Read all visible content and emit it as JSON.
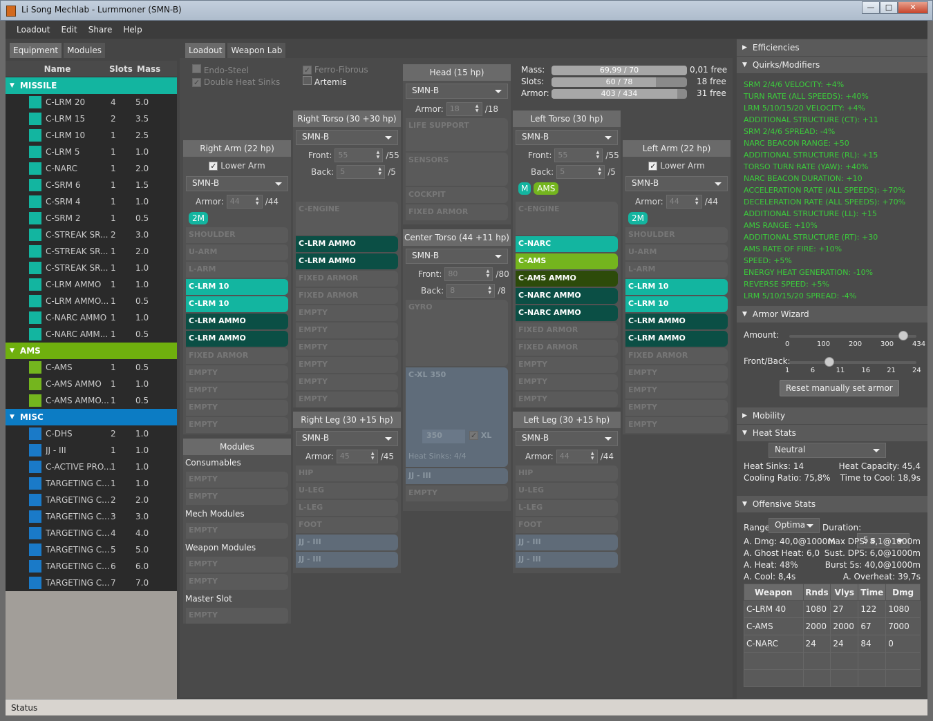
{
  "window": {
    "title": "Li Song Mechlab - Lurmmoner (SMN-B)",
    "min": "—",
    "max": "□",
    "close": "✕"
  },
  "menu": [
    "Loadout",
    "Edit",
    "Share",
    "Help"
  ],
  "left_tabs": [
    "Equipment",
    "Modules"
  ],
  "equipment": {
    "headers": {
      "name": "Name",
      "slots": "Slots",
      "mass": "Mass"
    },
    "categories": [
      {
        "name": "MISSILE",
        "color": "#13b5a0",
        "item_color": "#13b5a0",
        "items": [
          [
            "C-LRM 20",
            "4",
            "5.0"
          ],
          [
            "C-LRM 15",
            "2",
            "3.5"
          ],
          [
            "C-LRM 10",
            "1",
            "2.5"
          ],
          [
            "C-LRM 5",
            "1",
            "1.0"
          ],
          [
            "C-NARC",
            "1",
            "2.0"
          ],
          [
            "C-SRM 6",
            "1",
            "1.5"
          ],
          [
            "C-SRM 4",
            "1",
            "1.0"
          ],
          [
            "C-SRM 2",
            "1",
            "0.5"
          ],
          [
            "C-STREAK SR...",
            "2",
            "3.0"
          ],
          [
            "C-STREAK SR...",
            "1",
            "2.0"
          ],
          [
            "C-STREAK SR...",
            "1",
            "1.0"
          ],
          [
            "C-LRM AMMO",
            "1",
            "1.0"
          ],
          [
            "C-LRM AMMO...",
            "1",
            "0.5"
          ],
          [
            "C-NARC AMMO",
            "1",
            "1.0"
          ],
          [
            "C-NARC AMM...",
            "1",
            "0.5"
          ]
        ]
      },
      {
        "name": "AMS",
        "color": "#6fb00e",
        "item_color": "#74b51e",
        "items": [
          [
            "C-AMS",
            "1",
            "0.5"
          ],
          [
            "C-AMS AMMO",
            "1",
            "1.0"
          ],
          [
            "C-AMS AMMO...",
            "1",
            "0.5"
          ]
        ]
      },
      {
        "name": "MISC",
        "color": "#0c7cc4",
        "item_color": "#1a7ac8",
        "items": [
          [
            "C-DHS",
            "2",
            "1.0"
          ],
          [
            "JJ - III",
            "1",
            "1.0"
          ],
          [
            "C-ACTIVE PRO...",
            "1",
            "1.0"
          ],
          [
            "TARGETING C...",
            "1",
            "1.0"
          ],
          [
            "TARGETING C...",
            "2",
            "2.0"
          ],
          [
            "TARGETING C...",
            "3",
            "3.0"
          ],
          [
            "TARGETING C...",
            "4",
            "4.0"
          ],
          [
            "TARGETING C...",
            "5",
            "5.0"
          ],
          [
            "TARGETING C...",
            "6",
            "6.0"
          ],
          [
            "TARGETING C...",
            "7",
            "7.0"
          ]
        ]
      }
    ]
  },
  "center_tabs": [
    "Loadout",
    "Weapon Lab"
  ],
  "upgrades": {
    "endo": "Endo-Steel",
    "dhs": "Double Heat Sinks",
    "ferro": "Ferro-Fibrous",
    "artemis": "Artemis"
  },
  "summary": {
    "mass_label": "Mass:",
    "mass": "69,99 / 70",
    "mass_free": "0,01 free",
    "mass_frac": 0.9999,
    "slots_label": "Slots:",
    "slots": "60 / 78",
    "slots_free": "18 free",
    "slots_frac": 0.769,
    "armor_label": "Armor:",
    "armor": "403 / 434",
    "armor_free": "31 free",
    "armor_frac": 0.929
  },
  "parts": {
    "right_arm": {
      "title": "Right Arm (22 hp)",
      "lower_arm": "Lower Arm",
      "variant": "SMN-B",
      "armor_label": "Armor:",
      "armor": "44",
      "armor_max": "/44",
      "hardpoint": "2M",
      "slots": [
        [
          "SHOULDER",
          "gray"
        ],
        [
          "U-ARM",
          "gray"
        ],
        [
          "L-ARM",
          "gray"
        ],
        [
          "C-LRM 10",
          "teal"
        ],
        [
          "C-LRM 10",
          "teal"
        ],
        [
          "C-LRM AMMO",
          "dteal"
        ],
        [
          "C-LRM AMMO",
          "dteal"
        ],
        [
          "FIXED ARMOR",
          "gray"
        ],
        [
          "EMPTY",
          "gray"
        ],
        [
          "EMPTY",
          "gray"
        ],
        [
          "EMPTY",
          "gray"
        ],
        [
          "EMPTY",
          "gray"
        ]
      ]
    },
    "right_torso": {
      "title": "Right Torso (30 +30 hp)",
      "variant": "SMN-B",
      "front_label": "Front:",
      "front": "55",
      "front_max": "/55",
      "back_label": "Back:",
      "back": "5",
      "back_max": "/5",
      "engine": "C-ENGINE",
      "slots": [
        [
          "C-LRM AMMO",
          "dteal"
        ],
        [
          "C-LRM AMMO",
          "dteal"
        ],
        [
          "FIXED ARMOR",
          "gray"
        ],
        [
          "FIXED ARMOR",
          "gray"
        ],
        [
          "EMPTY",
          "gray"
        ],
        [
          "EMPTY",
          "gray"
        ],
        [
          "EMPTY",
          "gray"
        ],
        [
          "EMPTY",
          "gray"
        ],
        [
          "EMPTY",
          "gray"
        ],
        [
          "EMPTY",
          "gray"
        ]
      ]
    },
    "head": {
      "title": "Head (15 hp)",
      "variant": "SMN-B",
      "armor_label": "Armor:",
      "armor": "18",
      "armor_max": "/18",
      "slots": [
        [
          "LIFE SUPPORT",
          "big"
        ],
        [
          "SENSORS",
          "big"
        ],
        [
          "COCKPIT",
          "gray"
        ],
        [
          "FIXED ARMOR",
          "gray"
        ]
      ]
    },
    "center_torso": {
      "title": "Center Torso (44 +11 hp)",
      "variant": "SMN-B",
      "front_label": "Front:",
      "front": "80",
      "front_max": "/80",
      "back_label": "Back:",
      "back": "8",
      "back_max": "/8",
      "gyro": "GYRO",
      "engine": "C-XL 350",
      "engine_rating": "350",
      "xl": "XL",
      "heat_sinks": "Heat Sinks: 4/4",
      "jj": "JJ - III",
      "empty": "EMPTY"
    },
    "left_torso": {
      "title": "Left Torso (30 hp)",
      "variant": "SMN-B",
      "front_label": "Front:",
      "front": "55",
      "front_max": "/55",
      "back_label": "Back:",
      "back": "5",
      "back_max": "/5",
      "hp_m": "M",
      "hp_ams": "AMS",
      "engine": "C-ENGINE",
      "slots": [
        [
          "C-NARC",
          "teal"
        ],
        [
          "C-AMS",
          "green"
        ],
        [
          "C-AMS AMMO",
          "dgreen"
        ],
        [
          "C-NARC AMMO",
          "dteal"
        ],
        [
          "C-NARC AMMO",
          "dteal"
        ],
        [
          "FIXED ARMOR",
          "gray"
        ],
        [
          "FIXED ARMOR",
          "gray"
        ],
        [
          "EMPTY",
          "gray"
        ],
        [
          "EMPTY",
          "gray"
        ],
        [
          "EMPTY",
          "gray"
        ]
      ]
    },
    "left_arm": {
      "title": "Left Arm (22 hp)",
      "lower_arm": "Lower Arm",
      "variant": "SMN-B",
      "armor_label": "Armor:",
      "armor": "44",
      "armor_max": "/44",
      "hardpoint": "2M",
      "slots": [
        [
          "SHOULDER",
          "gray"
        ],
        [
          "U-ARM",
          "gray"
        ],
        [
          "L-ARM",
          "gray"
        ],
        [
          "C-LRM 10",
          "teal"
        ],
        [
          "C-LRM 10",
          "teal"
        ],
        [
          "C-LRM AMMO",
          "dteal"
        ],
        [
          "C-LRM AMMO",
          "dteal"
        ],
        [
          "FIXED ARMOR",
          "gray"
        ],
        [
          "EMPTY",
          "gray"
        ],
        [
          "EMPTY",
          "gray"
        ],
        [
          "EMPTY",
          "gray"
        ],
        [
          "EMPTY",
          "gray"
        ]
      ]
    },
    "right_leg": {
      "title": "Right Leg (30 +15 hp)",
      "variant": "SMN-B",
      "armor_label": "Armor:",
      "armor": "45",
      "armor_max": "/45",
      "slots": [
        [
          "HIP",
          "gray"
        ],
        [
          "U-LEG",
          "gray"
        ],
        [
          "L-LEG",
          "gray"
        ],
        [
          "FOOT",
          "gray"
        ],
        [
          "JJ - III",
          "blue"
        ],
        [
          "JJ - III",
          "blue"
        ]
      ]
    },
    "left_leg": {
      "title": "Left Leg (30 +15 hp)",
      "variant": "SMN-B",
      "armor_label": "Armor:",
      "armor": "44",
      "armor_max": "/44",
      "slots": [
        [
          "HIP",
          "gray"
        ],
        [
          "U-LEG",
          "gray"
        ],
        [
          "L-LEG",
          "gray"
        ],
        [
          "FOOT",
          "gray"
        ],
        [
          "JJ - III",
          "blue"
        ],
        [
          "JJ - III",
          "blue"
        ]
      ]
    }
  },
  "modules": {
    "title": "Modules",
    "consumables": "Consumables",
    "mech": "Mech Modules",
    "weapon": "Weapon Modules",
    "master": "Master Slot",
    "empty": "EMPTY"
  },
  "right": {
    "efficiencies": "Efficiencies",
    "quirks_title": "Quirks/Modifiers",
    "quirks": [
      "SRM 2/4/6 VELOCITY: +4%",
      "TURN RATE (ALL SPEEDS): +40%",
      "LRM 5/10/15/20 VELOCITY: +4%",
      "ADDITIONAL STRUCTURE (CT): +11",
      "SRM 2/4/6 SPREAD: -4%",
      "NARC BEACON RANGE: +50",
      "ADDITIONAL STRUCTURE (RL): +15",
      "TORSO TURN RATE (YAW): +40%",
      "NARC BEACON DURATION: +10",
      "ACCELERATION RATE (ALL SPEEDS): +70%",
      "DECELERATION RATE (ALL SPEEDS): +70%",
      "ADDITIONAL STRUCTURE (LL): +15",
      "AMS RANGE: +10%",
      "ADDITIONAL STRUCTURE (RT): +30",
      "AMS RATE OF FIRE: +10%",
      "SPEED: +5%",
      "ENERGY HEAT GENERATION: -10%",
      "REVERSE SPEED: +5%",
      "LRM 5/10/15/20 SPREAD: -4%"
    ],
    "armor_wizard": "Armor Wizard",
    "amount_label": "Amount:",
    "amount_ticks": [
      "0",
      "100",
      "200",
      "300",
      "434"
    ],
    "amount_value": 403,
    "amount_max": 434,
    "frontback_label": "Front/Back:",
    "frontback_ticks": [
      "1",
      "6",
      "11",
      "16",
      "21",
      "24"
    ],
    "frontback_value": 0.3,
    "reset": "Reset manually set armor",
    "mobility": "Mobility",
    "heat_title": "Heat Stats",
    "heat_env": "Neutral",
    "heat_sinks": "Heat Sinks: 14",
    "heat_capacity": "Heat Capacity: 45,4",
    "cooling": "Cooling Ratio: 75,8%",
    "time_cool": "Time to Cool: 18,9s",
    "offense_title": "Offensive Stats",
    "range_label": "Range:",
    "range": "Optima",
    "duration_label": "Duration:",
    "duration": "5 s",
    "a_dmg": "A. Dmg: 40,0@1000m",
    "max_dps": "Max DPS: 8,1@1000m",
    "a_ghost": "A. Ghost Heat: 6,0",
    "sust_dps": "Sust. DPS: 6,0@1000m",
    "a_heat": "A. Heat: 48%",
    "burst": "Burst 5s: 40,0@1000m",
    "a_cool": "A. Cool: 8,4s",
    "overheat": "A. Overheat: 39,7s",
    "weapon_headers": [
      "Weapon",
      "Rnds",
      "Vlys",
      "Time",
      "Dmg"
    ],
    "weapon_rows": [
      [
        "C-LRM 40",
        "1080",
        "27",
        "122",
        "1080"
      ],
      [
        "C-AMS",
        "2000",
        "2000",
        "67",
        "7000"
      ],
      [
        "C-NARC",
        "24",
        "24",
        "84",
        "0"
      ]
    ]
  },
  "status": "Status"
}
